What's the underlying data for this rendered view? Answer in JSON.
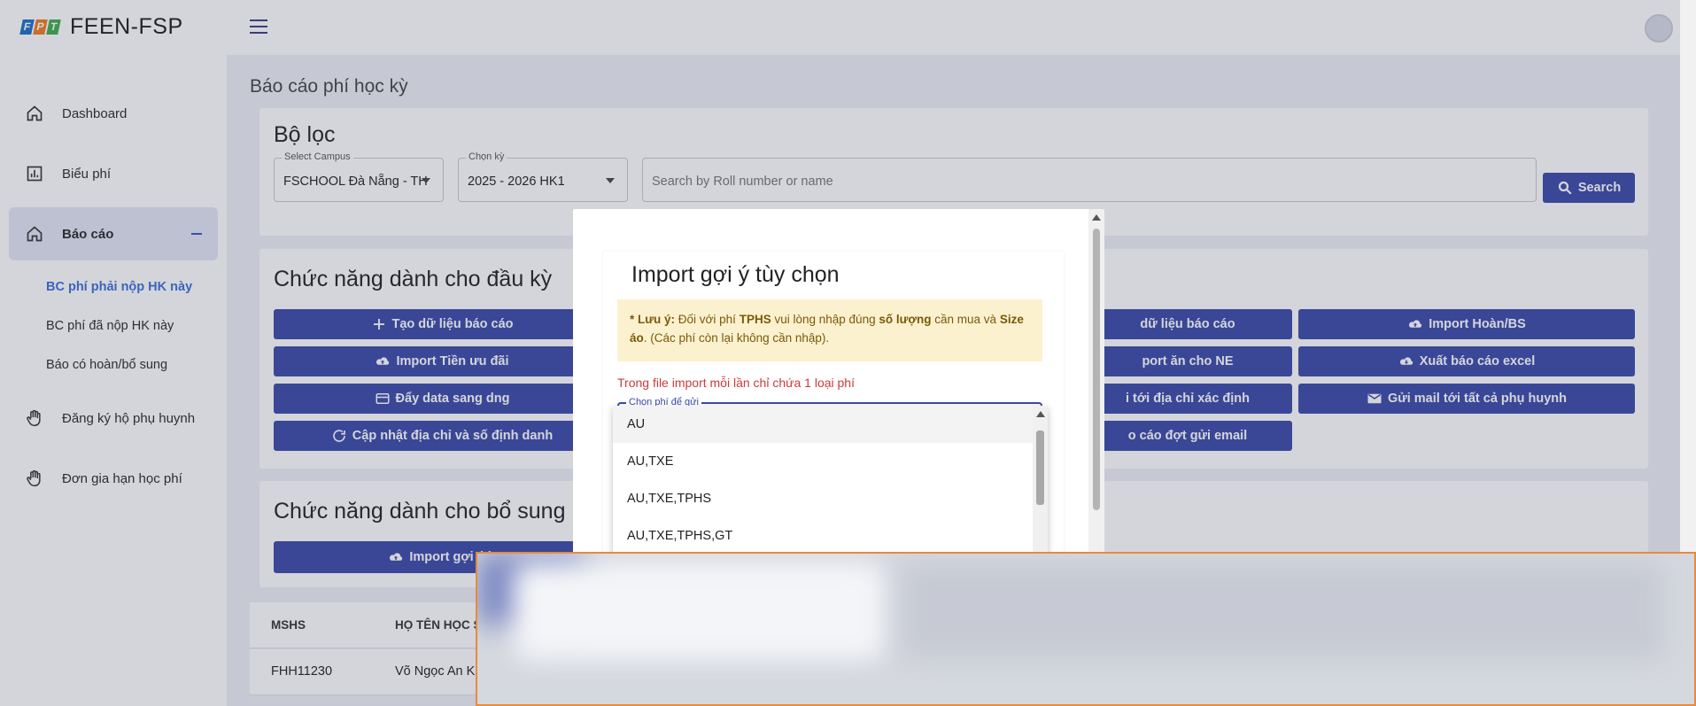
{
  "brand": {
    "name": "FEEN-FSP",
    "logo_letters": [
      "F",
      "P",
      "T"
    ],
    "logo_colors": [
      "#1d6fc8",
      "#f07b1e",
      "#3cae49"
    ]
  },
  "sidebar": {
    "items": [
      {
        "label": "Dashboard",
        "icon": "home-icon"
      },
      {
        "label": "Biểu phí",
        "icon": "chart-icon"
      },
      {
        "label": "Báo cáo",
        "icon": "home-icon",
        "active": true
      },
      {
        "label": "Đăng ký hộ phụ huynh",
        "icon": "hand-icon"
      },
      {
        "label": "Đơn gia hạn học phí",
        "icon": "hand-icon"
      }
    ],
    "sub_items": [
      {
        "label": "BC phí phải nộp HK này",
        "active": true
      },
      {
        "label": "BC phí đã nộp HK này"
      },
      {
        "label": "Báo có hoàn/bổ sung"
      }
    ]
  },
  "page": {
    "title": "Báo cáo phí học kỳ"
  },
  "filter": {
    "title": "Bộ lọc",
    "campus_label": "Select Campus",
    "campus_value": "FSCHOOL Đà Nẵng - TH",
    "term_label": "Chọn kỳ",
    "term_value": "2025 - 2026 HK1",
    "search_placeholder": "Search by Roll number or name",
    "search_button": "Search"
  },
  "functions_start": {
    "title": "Chức năng dành cho đầu kỳ",
    "col1": [
      "Tạo dữ liệu báo cáo",
      "Import Tiền ưu đãi",
      "Đẩy data sang dng",
      "Cập nhật địa chỉ và số định danh"
    ],
    "col3": [
      "dữ liệu báo cáo",
      "port ăn cho NE",
      "i tới địa chỉ xác định",
      "o cáo đợt gửi email"
    ],
    "col4": [
      "Import Hoàn/BS",
      "Xuất báo cáo excel",
      "Gửi mail tới tất cả phụ huynh"
    ]
  },
  "functions_extra": {
    "title": "Chức năng dành cho bổ sung",
    "button": "Import gợi ý b"
  },
  "table": {
    "headers": [
      "MSHS",
      "HỌ TÊN HỌC S"
    ],
    "rows": [
      [
        "FHH11230",
        "Võ Ngọc An Kh"
      ]
    ]
  },
  "modal": {
    "title": "Import gợi ý tùy chọn",
    "note_prefix": "* Lưu ý:",
    "note_text_1": "Đối với phí",
    "note_bold_1": "TPHS",
    "note_text_2": "vui lòng nhập đúng",
    "note_bold_2": "số lượng",
    "note_text_3": "cần mua và",
    "note_bold_3": "Size áo",
    "note_text_4": ". (Các phí còn lại không cần nhập).",
    "warning": "Trong file import mỗi lần chỉ chứa 1 loại phí",
    "select_label": "Chọn phí để gửi"
  },
  "dropdown": {
    "options": [
      "AU",
      "AU,TXE",
      "AU,TXE,TPHS",
      "AU,TXE,TPHS,GT"
    ]
  },
  "colors": {
    "primary": "#3a4aa8",
    "accent_link": "#3b6fd8",
    "warning_text": "#d03a3a",
    "note_bg": "#fcf1cf"
  }
}
